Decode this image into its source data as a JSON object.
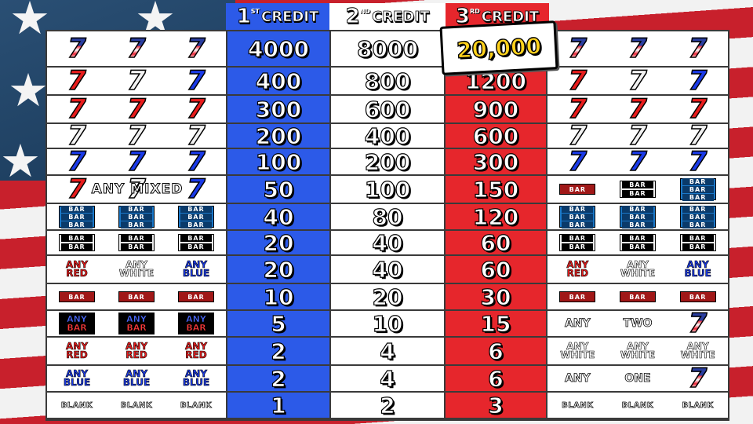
{
  "headers": [
    {
      "num": "1",
      "sup": "ST",
      "word": "CREDIT"
    },
    {
      "num": "2",
      "sup": "ND",
      "word": "CREDIT"
    },
    {
      "num": "3",
      "sup": "RD",
      "word": "CREDIT"
    }
  ],
  "jackpot": "20,000",
  "rows": [
    {
      "p1": "4000",
      "p2": "8000",
      "p3": ""
    },
    {
      "p1": "400",
      "p2": "800",
      "p3": "1200"
    },
    {
      "p1": "300",
      "p2": "600",
      "p3": "900"
    },
    {
      "p1": "200",
      "p2": "400",
      "p3": "600"
    },
    {
      "p1": "100",
      "p2": "200",
      "p3": "300"
    },
    {
      "p1": "50",
      "p2": "100",
      "p3": "150"
    },
    {
      "p1": "40",
      "p2": "80",
      "p3": "120"
    },
    {
      "p1": "20",
      "p2": "40",
      "p3": "60"
    },
    {
      "p1": "20",
      "p2": "40",
      "p3": "60"
    },
    {
      "p1": "10",
      "p2": "20",
      "p3": "30"
    },
    {
      "p1": "5",
      "p2": "10",
      "p3": "15"
    },
    {
      "p1": "2",
      "p2": "4",
      "p3": "6"
    },
    {
      "p1": "2",
      "p2": "4",
      "p3": "6"
    },
    {
      "p1": "1",
      "p2": "2",
      "p3": "3"
    }
  ],
  "labels": {
    "any_mixed": "ANY MIXED",
    "any": "ANY",
    "red": "RED",
    "white": "WHITE",
    "blue": "BLUE",
    "bar": "BAR",
    "blank": "BLANK",
    "two": "TWO",
    "one": "ONE",
    "seven": "7"
  },
  "colors": {
    "blue_col": "#2c5ae8",
    "white_col": "#ffffff",
    "red_col": "#e6262c",
    "jackpot": "#ffd21c"
  }
}
